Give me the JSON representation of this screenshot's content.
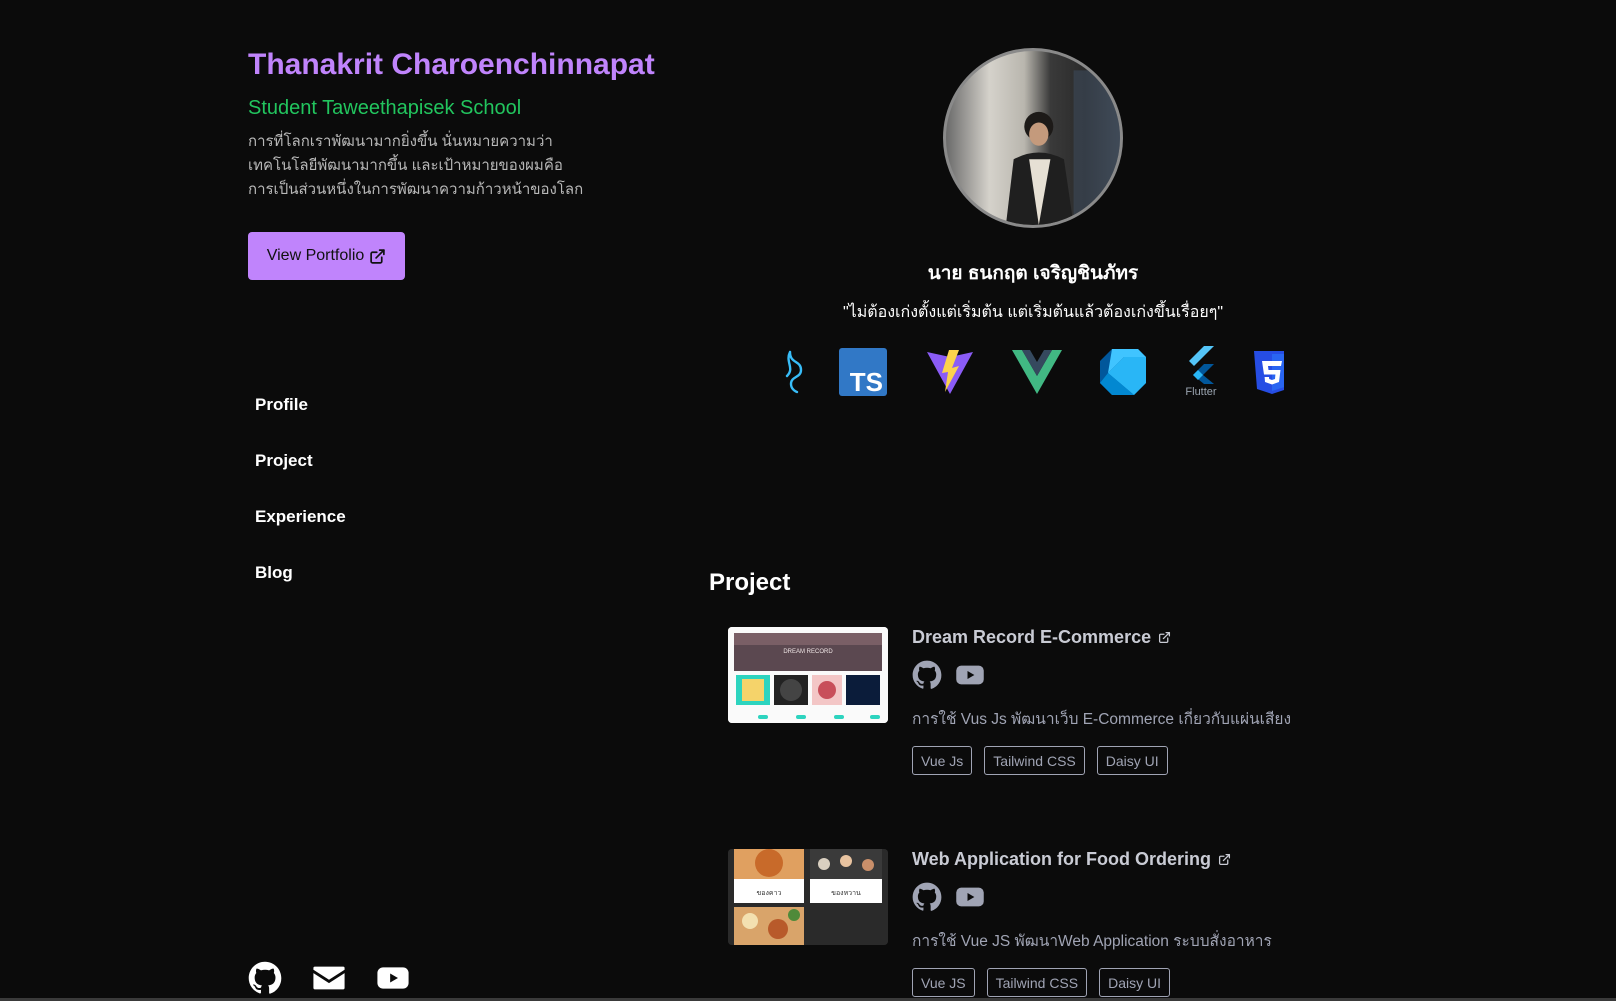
{
  "profile": {
    "name": "Thanakrit Charoenchinnapat",
    "role": "Student Taweethapisek School",
    "bio": [
      "การที่โลกเราพัฒนามากยิ่งขึ้น นั่นหมายความว่า",
      "เทคโนโลยีพัฒนามากขึ้น และเป้าหมายของผมคือ",
      "การเป็นส่วนหนึ่งในการพัฒนาความก้าวหน้าของโลก"
    ],
    "portfolio_button": "View Portfolio",
    "thai_name": "นาย ธนกฤต เจริญชินภัทร",
    "quote": "\"ไม่ต้องเก่งตั้งแต่เริ่มต้น แต่เริ่มต้นแล้วต้องเก่งขึ้นเรื่อยๆ\""
  },
  "nav": {
    "items": [
      {
        "label": "Profile"
      },
      {
        "label": "Project"
      },
      {
        "label": "Experience"
      },
      {
        "label": "Blog"
      }
    ]
  },
  "socials": {
    "icons": [
      "github-icon",
      "mail-icon",
      "youtube-icon"
    ]
  },
  "tech_stack": {
    "icons": [
      "bun-icon",
      "typescript-icon",
      "vite-icon",
      "vue-icon",
      "dart-icon",
      "flutter-icon",
      "css3-icon"
    ],
    "ts_label": "TS",
    "flutter_label": "Flutter"
  },
  "projects_section": {
    "title": "Project",
    "items": [
      {
        "title": "Dream Record E-Commerce",
        "description": "การใช้ Vus Js พัฒนาเว็บ E-Commerce เกี่ยวกับแผ่นเสียง",
        "tags": [
          "Vue Js",
          "Tailwind CSS",
          "Daisy UI"
        ],
        "thumb_labels": [
          "DREAM RECORD"
        ]
      },
      {
        "title": "Web Application for Food Ordering",
        "description": "การใช้ Vue JS พัฒนาWeb Application ระบบสั่งอาหาร",
        "tags": [
          "Vue JS",
          "Tailwind CSS",
          "Daisy UI"
        ],
        "thumb_labels": [
          "ของคาว",
          "ของหวาน"
        ]
      }
    ]
  },
  "colors": {
    "background": "#0b0b0b",
    "accent_purple": "#c084fc",
    "role_green": "#22c55e",
    "muted_text": "#a0a4b4"
  }
}
